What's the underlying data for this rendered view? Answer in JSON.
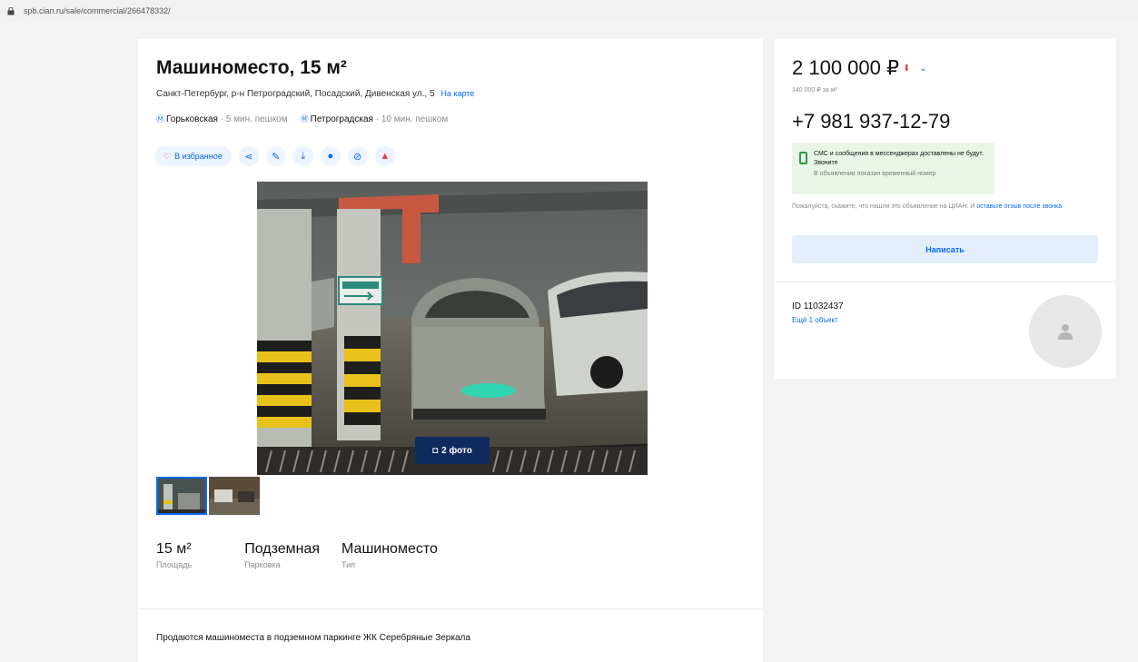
{
  "browser": {
    "url": "spb.cian.ru/sale/commercial/266478332/"
  },
  "listing": {
    "title": "Машиноместо, 15 м²",
    "address": "Санкт-Петербург, р-н Петроградский, Посадский, Дивенская ул., 5",
    "map_link": "На карте",
    "metro": [
      {
        "station": "Горьковская",
        "distance": "· 5 мин. пешком"
      },
      {
        "station": "Петроградская",
        "distance": "· 10 мин. пешком"
      }
    ],
    "favorite_label": "В избранное",
    "photo_count": "2 фото",
    "specs": [
      {
        "value": "15 м²",
        "label": "Площадь"
      },
      {
        "value": "Подземная",
        "label": "Парковка"
      },
      {
        "value": "Машиноместо",
        "label": "Тип"
      }
    ],
    "description": "Продаются машиноместа в подземном паркинге ЖК Серебряные Зеркала"
  },
  "sidebar": {
    "price": "2 100 000 ₽",
    "price_per_m2": "140 000 ₽ за м²",
    "phone": "+7 981 937-12-79",
    "sms_notice_title": "СМС и сообщения в мессенджерах доставлены не будут. Звоните",
    "sms_notice_sub": "В объявлении показан временный номер",
    "note_text": "Пожалуйста, скажите, что нашли это объявление на ЦИАН. И",
    "note_link": "оставьте отзыв после звонка",
    "write_button": "Написать",
    "agent_id": "ID 11032437",
    "agent_more": "Ещё 1 объект"
  },
  "colors": {
    "accent": "#0468ff",
    "price_down": "#ef3e4a",
    "sms_bg": "#eaf5e8"
  }
}
